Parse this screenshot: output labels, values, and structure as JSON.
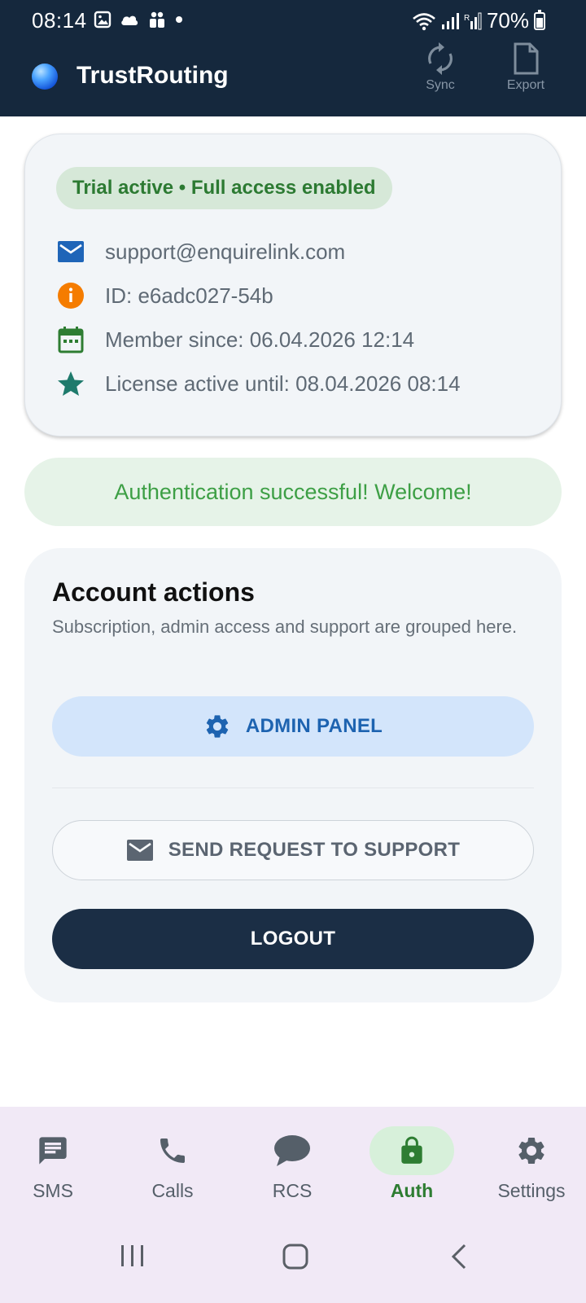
{
  "status_bar": {
    "time": "08:14",
    "battery": "70%"
  },
  "app": {
    "title": "TrustRouting",
    "actions": [
      {
        "label": "Sync",
        "icon": "sync-icon"
      },
      {
        "label": "Export",
        "icon": "document-icon"
      }
    ]
  },
  "profile_card": {
    "badge": "Trial active • Full access enabled",
    "email": "support@enquirelink.com",
    "id": "ID: e6adc027-54b",
    "member_since": "Member since: 06.04.2026 12:14",
    "license": "License active until: 08.04.2026 08:14"
  },
  "success_message": "Authentication successful! Welcome!",
  "account_actions": {
    "title": "Account actions",
    "subtitle": "Subscription, admin access and support are grouped here.",
    "admin_label": "ADMIN PANEL",
    "support_label": "SEND REQUEST TO SUPPORT",
    "logout_label": "LOGOUT"
  },
  "bottom_nav": [
    {
      "label": "SMS",
      "icon": "sms-icon"
    },
    {
      "label": "Calls",
      "icon": "phone-icon"
    },
    {
      "label": "RCS",
      "icon": "chat-bubble-icon"
    },
    {
      "label": "Auth",
      "icon": "lock-icon",
      "active": true
    },
    {
      "label": "Settings",
      "icon": "gear-icon"
    }
  ],
  "colors": {
    "header_bg": "#15283d",
    "success_green": "#3d9f45",
    "admin_blue": "#1d63b0",
    "logout_bg": "#1b2e45"
  }
}
